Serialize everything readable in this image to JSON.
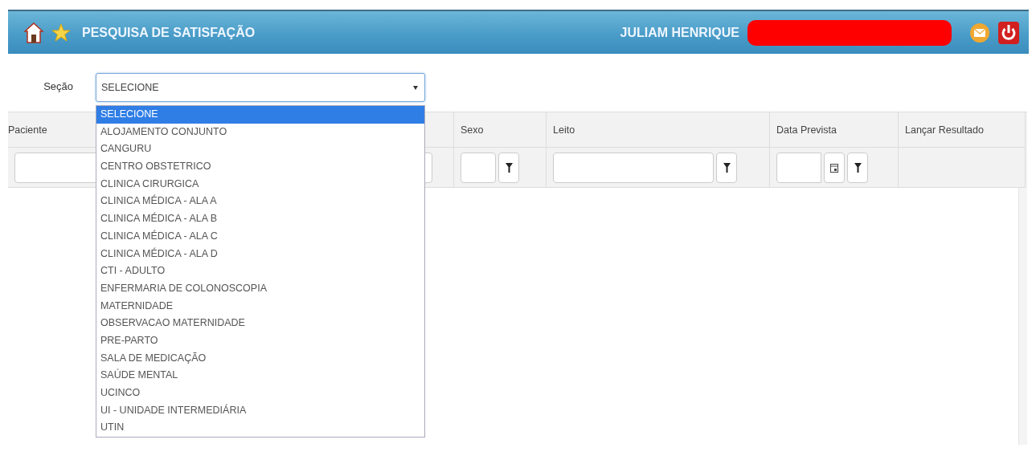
{
  "header": {
    "title": "PESQUISA DE SATISFAÇÃO",
    "user": "JULIAM HENRIQUE",
    "redacted": true
  },
  "section_filter": {
    "label": "Seção",
    "value": "SELECIONE",
    "expanded": true,
    "options": [
      {
        "label": "SELECIONE",
        "selected": true
      },
      {
        "label": "ALOJAMENTO CONJUNTO",
        "selected": false
      },
      {
        "label": "CANGURU",
        "selected": false
      },
      {
        "label": "CENTRO OBSTETRICO",
        "selected": false
      },
      {
        "label": "CLINICA CIRURGICA",
        "selected": false
      },
      {
        "label": "CLINICA MÉDICA - ALA A",
        "selected": false
      },
      {
        "label": "CLINICA MÉDICA - ALA B",
        "selected": false
      },
      {
        "label": "CLINICA MÉDICA - ALA C",
        "selected": false
      },
      {
        "label": "CLINICA MÉDICA - ALA D",
        "selected": false
      },
      {
        "label": "CTI - ADULTO",
        "selected": false
      },
      {
        "label": "ENFERMARIA DE COLONOSCOPIA",
        "selected": false
      },
      {
        "label": "MATERNIDADE",
        "selected": false
      },
      {
        "label": "OBSERVACAO MATERNIDADE",
        "selected": false
      },
      {
        "label": "PRE-PARTO",
        "selected": false
      },
      {
        "label": "SALA DE MEDICAÇÃO",
        "selected": false
      },
      {
        "label": "SAÚDE MENTAL",
        "selected": false
      },
      {
        "label": "UCINCO",
        "selected": false
      },
      {
        "label": "UI - UNIDADE INTERMEDIÁRIA",
        "selected": false
      },
      {
        "label": "UTIN",
        "selected": false
      }
    ]
  },
  "table": {
    "columns": [
      {
        "label": "Paciente",
        "kind": "input"
      },
      {
        "label": "Sexo",
        "kind": "text"
      },
      {
        "label": "Leito",
        "kind": "text"
      },
      {
        "label": "Data Prevista",
        "kind": "date"
      },
      {
        "label": "Lançar Resultado",
        "kind": "none"
      }
    ]
  }
}
